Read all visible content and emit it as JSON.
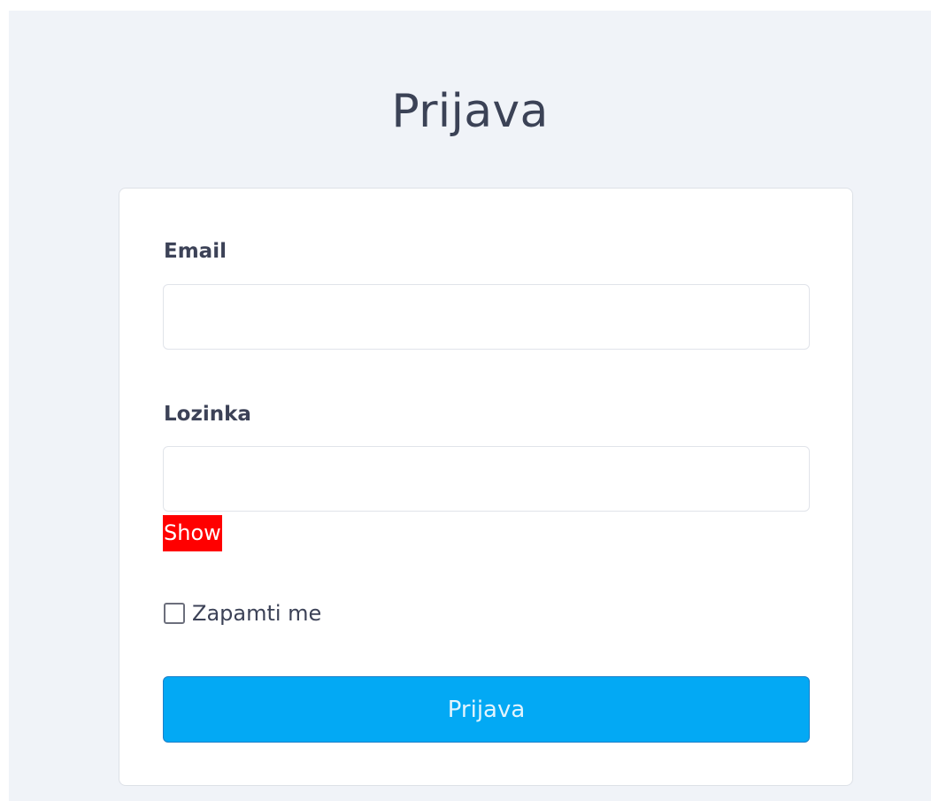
{
  "header": {
    "title": "Prijava"
  },
  "form": {
    "email": {
      "label": "Email",
      "value": "",
      "placeholder": ""
    },
    "password": {
      "label": "Lozinka",
      "value": "",
      "placeholder": "",
      "show_label": "Show"
    },
    "remember": {
      "label": "Zapamti me",
      "checked": false
    },
    "submit_label": "Prijava"
  },
  "colors": {
    "page_background": "#f0f3f8",
    "card_background": "#ffffff",
    "submit_button": "#03a9f4",
    "show_toggle": "#ff0000",
    "text": "#3c4257"
  }
}
